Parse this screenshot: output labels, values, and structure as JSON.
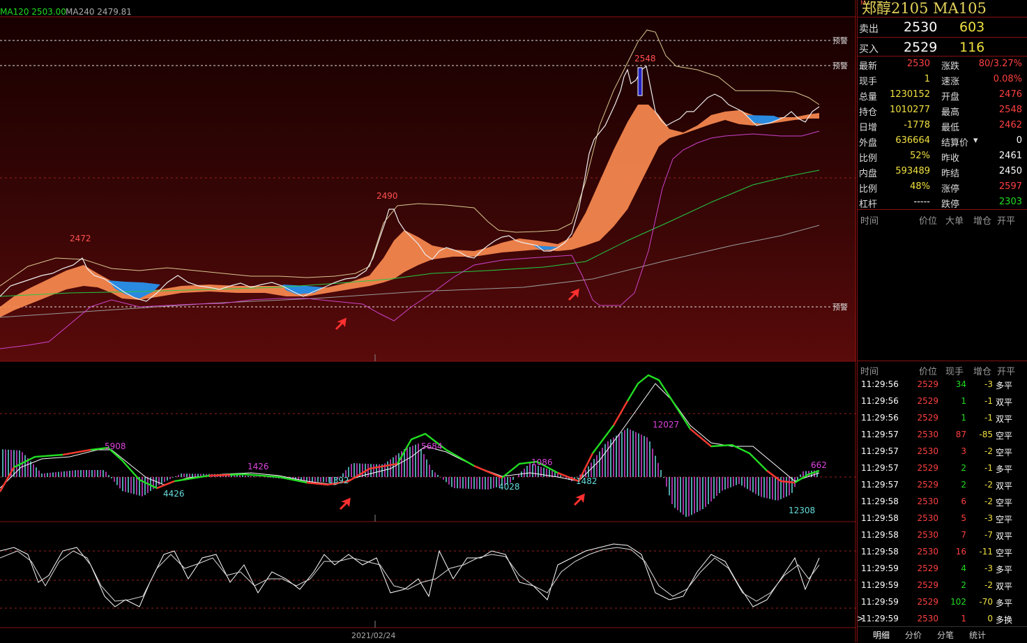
{
  "main_chart": {
    "ma_legend": [
      {
        "label": "MA120",
        "value": "2503.00",
        "color": "#22dd22"
      },
      {
        "label": "MA240",
        "value": "2479.81",
        "color": "#aaaaaa"
      }
    ],
    "alerts": [
      "预警",
      "预警",
      "预警"
    ],
    "peak_labels": [
      "2472",
      "2490",
      "2548"
    ],
    "date_label": "2021/02/24"
  },
  "macd_labels": [
    "5908",
    "4426",
    "1426",
    "1392",
    "5684",
    "4028",
    "1086",
    "1482",
    "12027",
    "12308",
    "662"
  ],
  "side": {
    "title_mark": "M",
    "title": "郑醇2105  MA105",
    "sell": {
      "label": "卖出",
      "price": "2530",
      "volume": "603"
    },
    "buy": {
      "label": "买入",
      "price": "2529",
      "volume": "116"
    },
    "quotes": [
      {
        "l1": "最新",
        "v1": "2530",
        "c1": "red",
        "l2": "涨跌",
        "v2": "80/3.27%",
        "c2": "red"
      },
      {
        "l1": "现手",
        "v1": "1",
        "c1": "yel",
        "l2": "速涨",
        "v2": "0.08%",
        "c2": "red"
      },
      {
        "l1": "总量",
        "v1": "1230152",
        "c1": "yel",
        "l2": "开盘",
        "v2": "2476",
        "c2": "red"
      },
      {
        "l1": "持仓",
        "v1": "1010277",
        "c1": "yel",
        "l2": "最高",
        "v2": "2548",
        "c2": "red"
      },
      {
        "l1": "日增",
        "v1": "-1778",
        "c1": "yel",
        "l2": "最低",
        "v2": "2462",
        "c2": "red"
      },
      {
        "l1": "外盘",
        "v1": "636664",
        "c1": "yel",
        "l2": "结算价",
        "v2": "0",
        "c2": "wht"
      },
      {
        "l1": "比例",
        "v1": "52%",
        "c1": "yel",
        "l2": "昨收",
        "v2": "2461",
        "c2": "wht"
      },
      {
        "l1": "内盘",
        "v1": "593489",
        "c1": "yel",
        "l2": "昨结",
        "v2": "2450",
        "c2": "wht"
      },
      {
        "l1": "比例",
        "v1": "48%",
        "c1": "yel",
        "l2": "涨停",
        "v2": "2597",
        "c2": "red"
      },
      {
        "l1": "杠杆",
        "v1": "-----",
        "c1": "wht",
        "l2": "跌停",
        "v2": "2303",
        "c2": "green"
      }
    ],
    "big_order_header": [
      "时间",
      "价位",
      "大单",
      "增仓",
      "开平"
    ],
    "tick_header": [
      "时间",
      "价位",
      "现手",
      "增仓",
      "开平"
    ],
    "ticks": [
      {
        "time": "11:29:56",
        "price": "2529",
        "pc": "red",
        "qty": "34",
        "qc": "green",
        "chg": "-3",
        "type": "多平"
      },
      {
        "time": "11:29:56",
        "price": "2529",
        "pc": "red",
        "qty": "1",
        "qc": "green",
        "chg": "-1",
        "type": "双平"
      },
      {
        "time": "11:29:56",
        "price": "2529",
        "pc": "red",
        "qty": "1",
        "qc": "green",
        "chg": "-1",
        "type": "双平"
      },
      {
        "time": "11:29:57",
        "price": "2530",
        "pc": "red",
        "qty": "87",
        "qc": "red",
        "chg": "-85",
        "type": "空平"
      },
      {
        "time": "11:29:57",
        "price": "2530",
        "pc": "red",
        "qty": "3",
        "qc": "red",
        "chg": "-2",
        "type": "空平"
      },
      {
        "time": "11:29:57",
        "price": "2529",
        "pc": "red",
        "qty": "2",
        "qc": "green",
        "chg": "-1",
        "type": "多平"
      },
      {
        "time": "11:29:57",
        "price": "2529",
        "pc": "red",
        "qty": "2",
        "qc": "green",
        "chg": "-2",
        "type": "双平"
      },
      {
        "time": "11:29:58",
        "price": "2530",
        "pc": "red",
        "qty": "6",
        "qc": "red",
        "chg": "-2",
        "type": "空平"
      },
      {
        "time": "11:29:58",
        "price": "2530",
        "pc": "red",
        "qty": "5",
        "qc": "red",
        "chg": "-3",
        "type": "空平"
      },
      {
        "time": "11:29:58",
        "price": "2530",
        "pc": "red",
        "qty": "7",
        "qc": "red",
        "chg": "-7",
        "type": "双平"
      },
      {
        "time": "11:29:58",
        "price": "2530",
        "pc": "red",
        "qty": "16",
        "qc": "red",
        "chg": "-11",
        "type": "空平"
      },
      {
        "time": "11:29:59",
        "price": "2529",
        "pc": "red",
        "qty": "4",
        "qc": "green",
        "chg": "-3",
        "type": "多平"
      },
      {
        "time": "11:29:59",
        "price": "2529",
        "pc": "red",
        "qty": "2",
        "qc": "green",
        "chg": "-2",
        "type": "双平"
      },
      {
        "time": "11:29:59",
        "price": "2529",
        "pc": "red",
        "qty": "102",
        "qc": "green",
        "chg": "-70",
        "type": "多平"
      },
      {
        "time": "11:29:59",
        "price": "2530",
        "pc": "red",
        "qty": "1",
        "qc": "red",
        "chg": "0",
        "type": "多换"
      }
    ],
    "last_row_marker": ">",
    "tabs": [
      "明细",
      "分价",
      "分笔",
      "统计"
    ]
  }
}
